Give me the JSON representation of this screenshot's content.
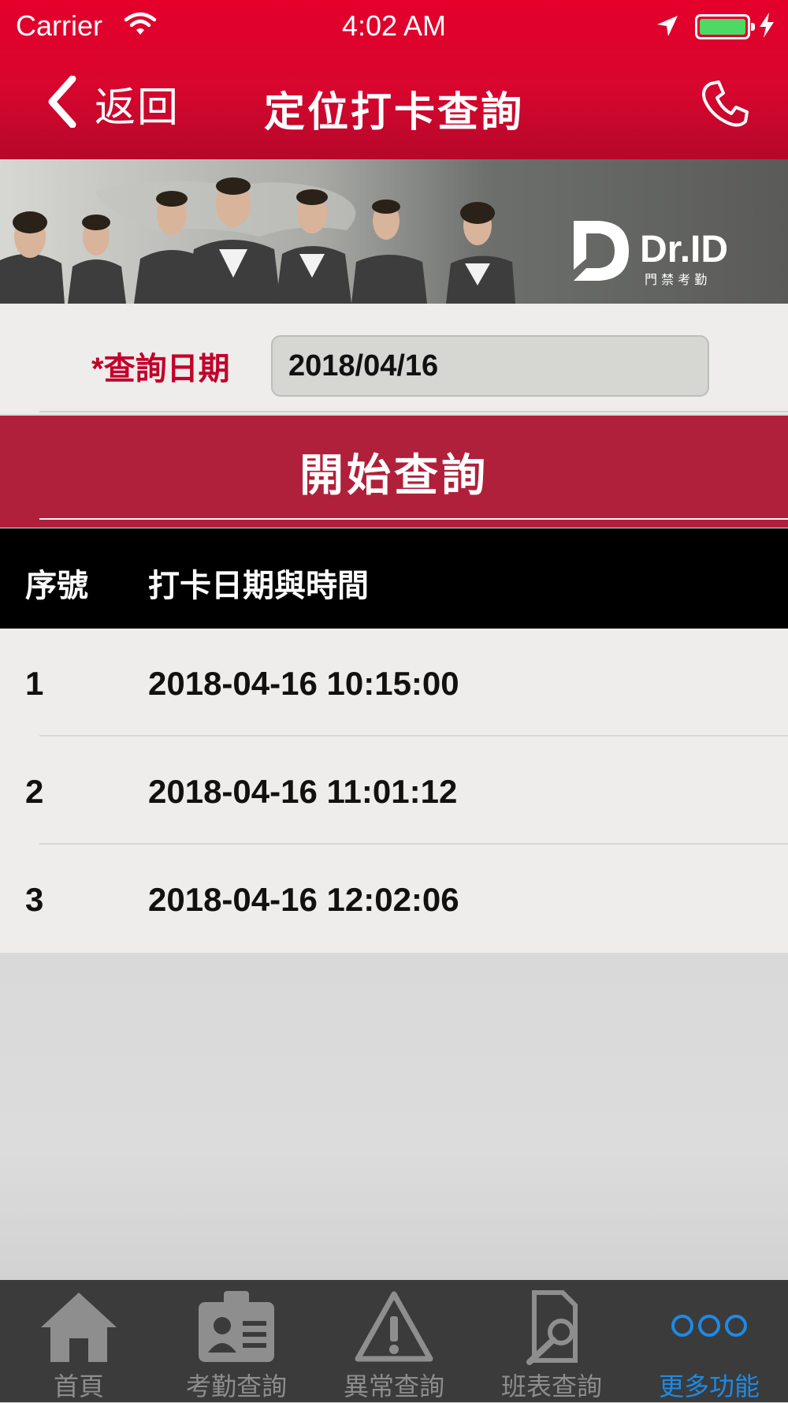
{
  "status_bar": {
    "carrier": "Carrier",
    "time": "4:02 AM"
  },
  "nav": {
    "back_label": "返回",
    "title": "定位打卡查詢"
  },
  "banner": {
    "logo_text": "Dr.ID",
    "logo_sub": "門 禁 考 勤"
  },
  "form": {
    "required_mark": "*",
    "date_label": "查詢日期",
    "date_value": "2018/04/16"
  },
  "query_button": {
    "label": "開始查詢"
  },
  "table": {
    "headers": [
      "序號",
      "打卡日期與時間"
    ],
    "rows": [
      {
        "index": "1",
        "datetime": "2018-04-16 10:15:00"
      },
      {
        "index": "2",
        "datetime": "2018-04-16 11:01:12"
      },
      {
        "index": "3",
        "datetime": "2018-04-16 12:02:06"
      }
    ]
  },
  "tabs": [
    {
      "label": "首頁",
      "icon": "home-icon",
      "active": false
    },
    {
      "label": "考勤查詢",
      "icon": "id-card-icon",
      "active": false
    },
    {
      "label": "異常查詢",
      "icon": "warning-icon",
      "active": false
    },
    {
      "label": "班表查詢",
      "icon": "schedule-search-icon",
      "active": false
    },
    {
      "label": "更多功能",
      "icon": "more-icon",
      "active": true
    }
  ],
  "colors": {
    "brand_red": "#e4002b",
    "button_red": "#b0203a",
    "active_tab": "#1e8ae6",
    "tab_bar": "#3b3b3b"
  }
}
